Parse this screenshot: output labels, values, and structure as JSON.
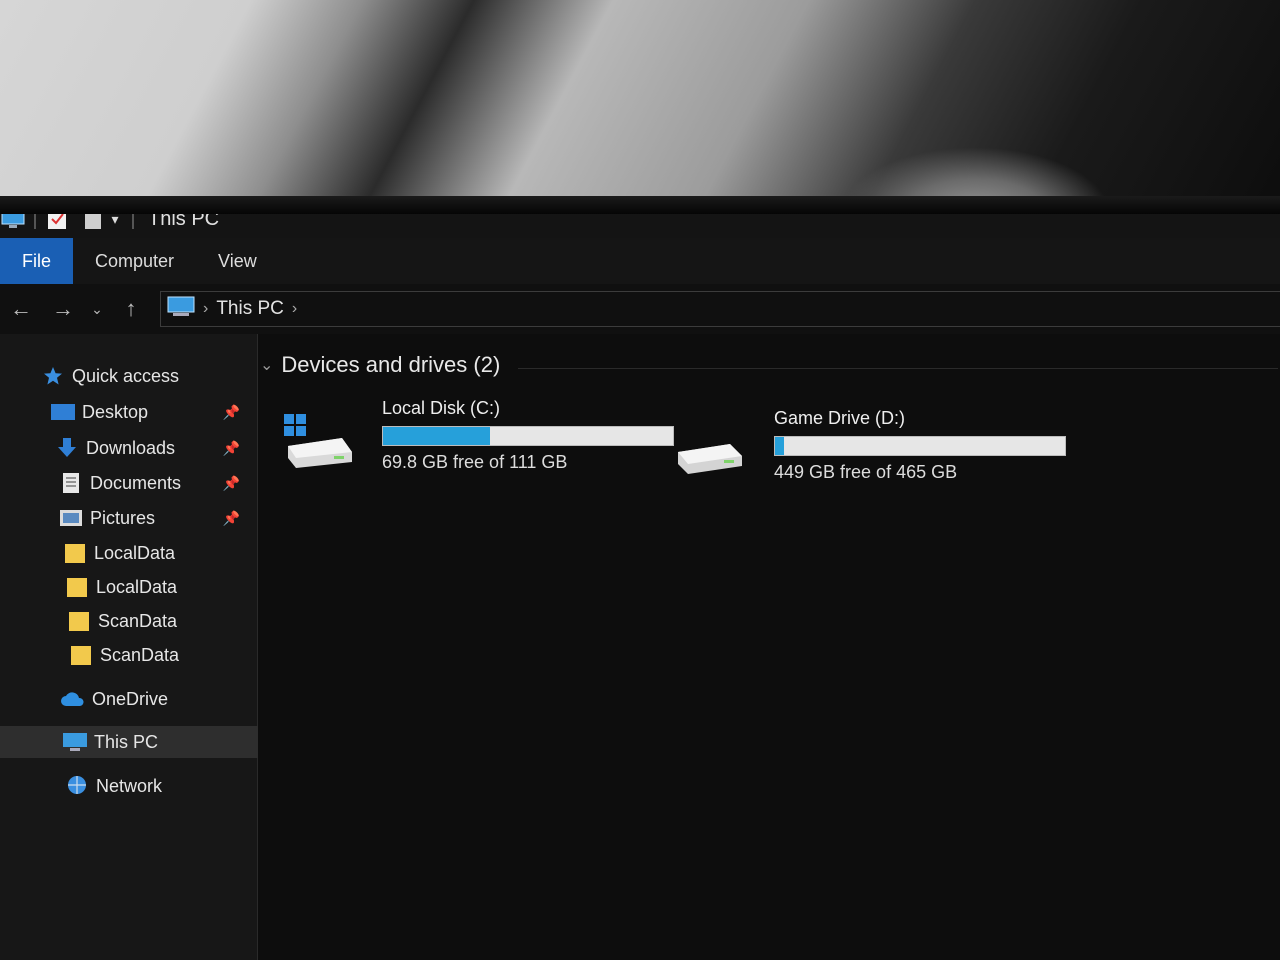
{
  "window": {
    "title": "This PC"
  },
  "ribbon": {
    "tabs": [
      "File",
      "Computer",
      "View"
    ]
  },
  "address": {
    "location": "This PC"
  },
  "sidebar": {
    "items": [
      {
        "label": "Quick access",
        "icon": "star-icon",
        "pinned": false
      },
      {
        "label": "Desktop",
        "icon": "desktop-icon",
        "pinned": true
      },
      {
        "label": "Downloads",
        "icon": "download-icon",
        "pinned": true
      },
      {
        "label": "Documents",
        "icon": "document-icon",
        "pinned": true
      },
      {
        "label": "Pictures",
        "icon": "pictures-icon",
        "pinned": true
      },
      {
        "label": "LocalData",
        "icon": "folder-icon",
        "pinned": false
      },
      {
        "label": "LocalData",
        "icon": "folder-icon",
        "pinned": false
      },
      {
        "label": "ScanData",
        "icon": "folder-icon",
        "pinned": false
      },
      {
        "label": "ScanData",
        "icon": "folder-icon",
        "pinned": false
      },
      {
        "label": "OneDrive",
        "icon": "cloud-icon",
        "pinned": false
      },
      {
        "label": "This PC",
        "icon": "computer-icon",
        "pinned": false,
        "selected": true
      },
      {
        "label": "Network",
        "icon": "network-icon",
        "pinned": false
      }
    ]
  },
  "main": {
    "group_title": "Devices and drives (2)",
    "drives": [
      {
        "name": "Local Disk (C:)",
        "free_text": "69.8 GB free of 111 GB",
        "used_fraction": 0.37
      },
      {
        "name": "Game Drive (D:)",
        "free_text": "449 GB free of 465 GB",
        "used_fraction": 0.03
      }
    ]
  },
  "colors": {
    "accent": "#1a5fb4",
    "drive_bar_fill": "#26a0da",
    "background": "#0d0d0d"
  }
}
